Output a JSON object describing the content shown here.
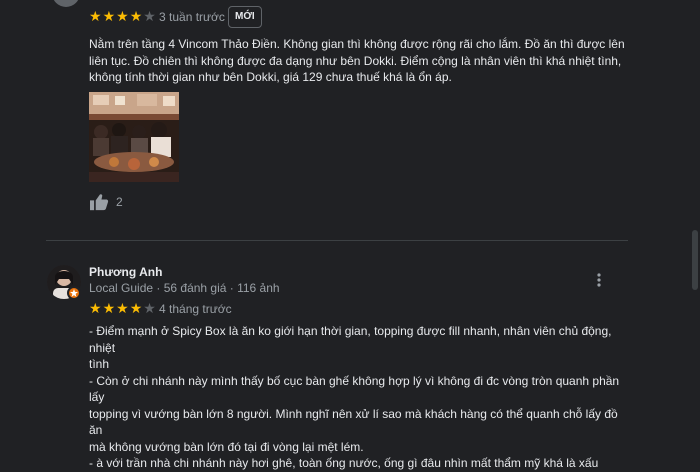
{
  "review1": {
    "rating": 4,
    "max_rating": 5,
    "time": "3 tuần trước",
    "new_badge": "MỚI",
    "lines": [
      "Nằm trên tầng 4 Vincom Thảo Điền. Không gian thì không được rộng rãi cho lắm. Đồ ăn thì được lên",
      "liên tục. Đồ chiên thì không được đa dạng như bên Dokki. Điểm cộng là nhân viên thì khá nhiệt tình,",
      "không tính thời gian như bên Dokki, giá 129 chưa thuế khá là ổn áp."
    ],
    "likes": "2",
    "icons": [
      "thumbs-up-icon"
    ]
  },
  "review2": {
    "name": "Phương Anh",
    "meta": "Local Guide · 56 đánh giá · 116 ảnh",
    "rating": 4,
    "max_rating": 5,
    "time": "4 tháng trước",
    "lines": [
      "- Điểm mạnh ở Spicy Box là ăn ko giới hạn thời gian, topping được fill nhanh, nhân viên chủ động, nhiệt",
      "tình",
      "- Còn ở chi nhánh này mình thấy bố cục bàn ghế không hợp lý vì không đi đc vòng tròn quanh phần lấy",
      "topping vì vướng bàn lớn 8 người. Mình nghĩ nên xử lí sao mà khách hàng có thể quanh chỗ lấy đồ ăn",
      "mà không vướng bàn lớn đó tại đi vòng lại mệt lém.",
      "- à với trần nhà chi nhánh này hơi ghê, toàn ống nước, ống gì đâu nhìn mất thẩm mỹ khá là xấu"
    ],
    "icons": [
      "avatar",
      "local-guide-icon",
      "more-vert-icon"
    ]
  },
  "colors": {
    "background": "#202124",
    "star": "#fbbc04",
    "star_empty": "#5f6368",
    "text": "#e8eaed",
    "muted": "#9aa0a6",
    "guide_badge": "#e8710a"
  }
}
